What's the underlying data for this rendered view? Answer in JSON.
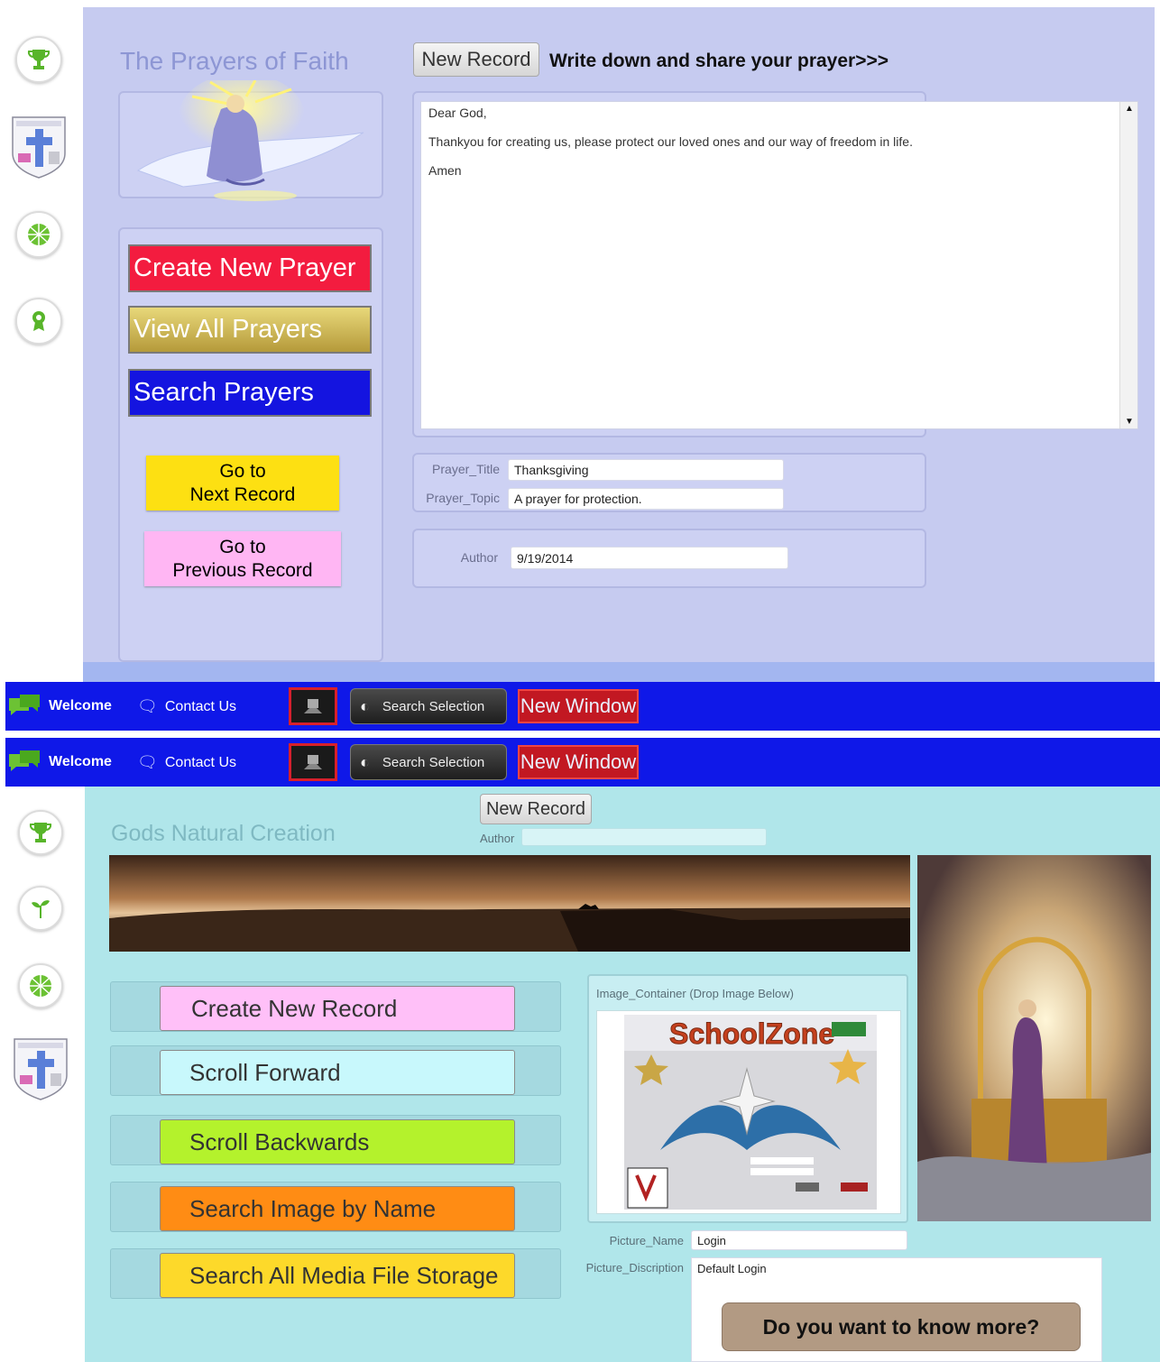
{
  "top": {
    "title": "The Prayers of Faith",
    "new_record_label": "New Record",
    "instruction": "Write down and share your prayer>>>",
    "buttons": {
      "create": "Create New Prayer",
      "view_all": "View All Prayers",
      "search": "Search Prayers",
      "next_line1": "Go to",
      "next_line2": "Next Record",
      "prev_line1": "Go to",
      "prev_line2": "Previous Record"
    },
    "prayer_text": {
      "line1": "Dear God,",
      "line2": "Thankyou for creating us, please protect our loved ones and our way of freedom in life.",
      "line3": "Amen"
    },
    "fields": {
      "title_label": "Prayer_Title",
      "title_value": "Thanksgiving",
      "topic_label": "Prayer_Topic",
      "topic_value": "A prayer for protection.",
      "author_label": "Author",
      "author_value": "9/19/2014"
    }
  },
  "taskbar": {
    "welcome": "Welcome",
    "contact": "Contact Us",
    "search_selection": "Search Selection",
    "new_window": "New Window"
  },
  "bottom": {
    "title": "Gods Natural Creation",
    "new_record_label": "New Record",
    "author_label": "Author",
    "author_value": "",
    "buttons": {
      "create": "Create New Record",
      "forward": "Scroll Forward",
      "backward": "Scroll Backwards",
      "search_image": "Search Image by Name",
      "search_media": "Search All Media File Storage"
    },
    "image_container_label": "Image_Container (Drop Image Below)",
    "schoolzone_text": "SchoolZone",
    "picture_name_label": "Picture_Name",
    "picture_name_value": "Login",
    "picture_desc_label": "Picture_Discription",
    "picture_desc_value": "Default Login",
    "know_more": "Do you want to know more?"
  },
  "colors": {
    "top_bg": "#c6cbf0",
    "bottom_bg": "#b0e6ea",
    "taskbar": "#0f18e8",
    "create_prayer": "#f31c3f",
    "view_all": "#c9b04a",
    "search_prayers": "#1414e0",
    "next_record": "#fde012",
    "prev_record": "#ffb6f3",
    "create_record": "#ffc0f8",
    "scroll_forward": "#c8f8fc",
    "scroll_backwards": "#b4f22c",
    "search_image": "#ff8c14",
    "search_media": "#fdd92a"
  }
}
